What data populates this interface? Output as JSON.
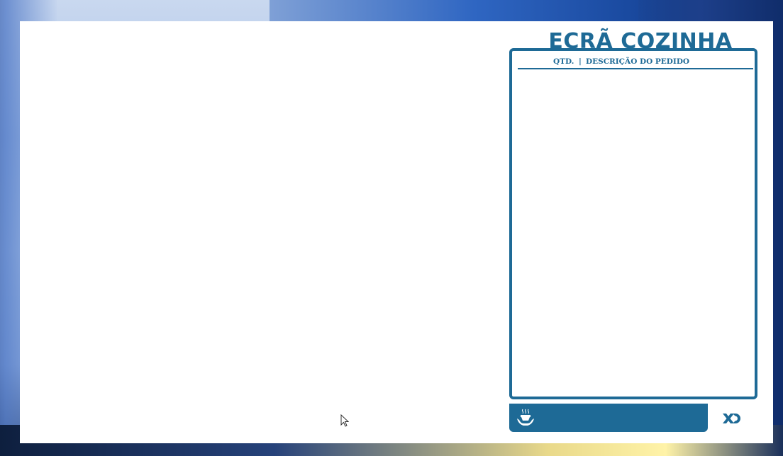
{
  "app": {
    "title": "ECRÃ COZINHA"
  },
  "order_panel": {
    "header_qty": "QTD.",
    "header_separator": "|",
    "header_description": "DESCRIÇÃO DO PEDIDO",
    "items": []
  },
  "footer": {
    "left_icon": "serving-hands-icon",
    "right_logo": "xd-logo"
  },
  "colors": {
    "accent": "#1e6a96",
    "window_background": "#ffffff"
  }
}
